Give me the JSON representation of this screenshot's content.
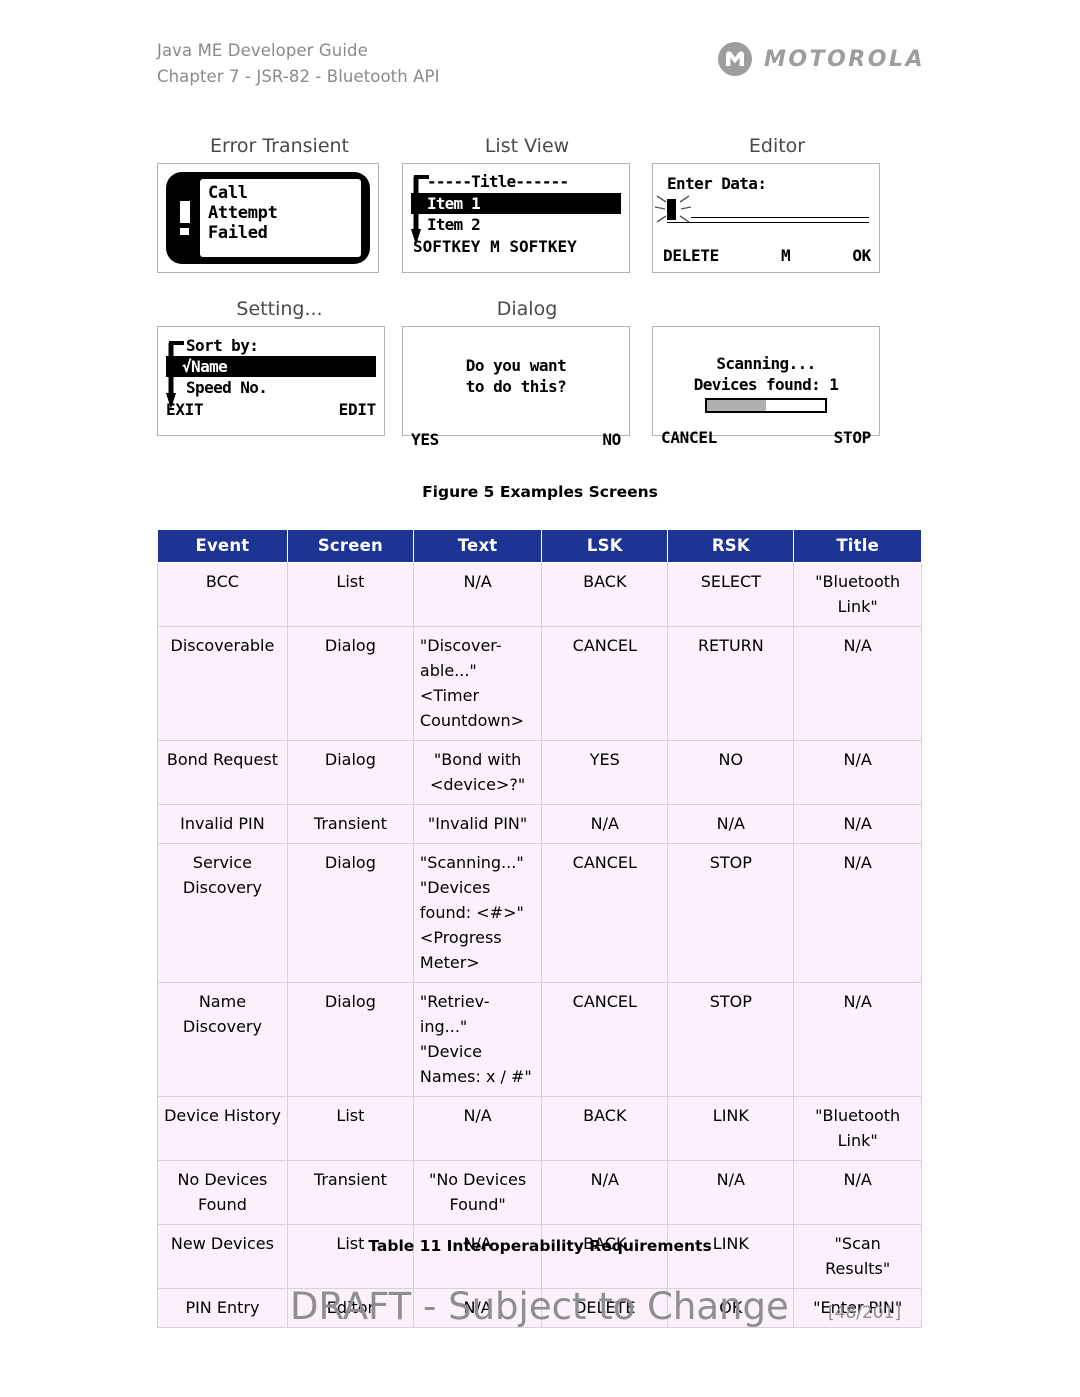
{
  "header": {
    "doc_title": "Java ME Developer Guide",
    "chapter": "Chapter 7 - JSR-82 - Bluetooth API",
    "brand": "MOTOROLA"
  },
  "figure": {
    "caption": "Figure 5 Examples Screens",
    "screens": [
      {
        "label": "Error Transient",
        "kind": "transient",
        "icon": "exclamation-icon",
        "lines": [
          "Call",
          "Attempt",
          "Failed"
        ]
      },
      {
        "label": "List View",
        "kind": "list",
        "title_line": "-----Title------",
        "selected_item": "Item 1",
        "item": "Item 2",
        "softkeys": "SOFTKEY M SOFTKEY",
        "scroll_indicator": "down-arrow-icon"
      },
      {
        "label": "Editor",
        "kind": "editor",
        "prompt": "Enter Data:",
        "value": "",
        "lsk": "DELETE",
        "msk": "M",
        "rsk": "OK",
        "cursor": "blinking-cursor-icon"
      },
      {
        "label": "Setting...",
        "kind": "setting",
        "title_line": "Sort by:",
        "selected_item": "√Name",
        "item": "Speed No.",
        "lsk": "EXIT",
        "rsk": "EDIT",
        "scroll_indicator": "down-arrow-icon"
      },
      {
        "label": "Dialog",
        "kind": "dialog",
        "message_line1": "Do you want",
        "message_line2": "to do this?",
        "lsk": "YES",
        "rsk": "NO"
      },
      {
        "label": "",
        "kind": "progress",
        "message_line1": "Scanning...",
        "message_line2": "Devices found: 1",
        "progress_percent": 50,
        "lsk": "CANCEL",
        "rsk": "STOP"
      }
    ]
  },
  "table": {
    "caption": "Table 11 Interoperability Requirements",
    "columns": [
      "Event",
      "Screen",
      "Text",
      "LSK",
      "RSK",
      "Title"
    ],
    "rows": [
      {
        "event": "BCC",
        "screen": "List",
        "text": "N/A",
        "lsk": "BACK",
        "rsk": "SELECT",
        "title": "\"Bluetooth Link\""
      },
      {
        "event": "Discoverable",
        "screen": "Dialog",
        "text": "\"Discover-able...\"\n<Timer Countdown>",
        "lsk": "CANCEL",
        "rsk": "RETURN",
        "title": "N/A"
      },
      {
        "event": "Bond Request",
        "screen": "Dialog",
        "text": "\"Bond with <device>?\"",
        "lsk": "YES",
        "rsk": "NO",
        "title": "N/A"
      },
      {
        "event": "Invalid PIN",
        "screen": "Transient",
        "text": "\"Invalid PIN\"",
        "lsk": "N/A",
        "rsk": "N/A",
        "title": "N/A"
      },
      {
        "event": "Service Discovery",
        "screen": "Dialog",
        "text": "\"Scanning...\"\n\"Devices found: <#>\"\n<Progress Meter>",
        "lsk": "CANCEL",
        "rsk": "STOP",
        "title": "N/A"
      },
      {
        "event": "Name Discovery",
        "screen": "Dialog",
        "text": "\"Retriev-ing...\"\n\"Device Names: x / #\"",
        "lsk": "CANCEL",
        "rsk": "STOP",
        "title": "N/A"
      },
      {
        "event": "Device History",
        "screen": "List",
        "text": "N/A",
        "lsk": "BACK",
        "rsk": "LINK",
        "title": "\"Bluetooth Link\""
      },
      {
        "event": "No Devices Found",
        "screen": "Transient",
        "text": "\"No Devices Found\"",
        "lsk": "N/A",
        "rsk": "N/A",
        "title": "N/A"
      },
      {
        "event": "New Devices",
        "screen": "List",
        "text": "N/A",
        "lsk": "BACK",
        "rsk": "LINK",
        "title": "\"Scan Results\""
      },
      {
        "event": "PIN Entry",
        "screen": "Editor",
        "text": "N/A",
        "lsk": "DELETE",
        "rsk": "OK",
        "title": "\"Enter PIN\""
      }
    ]
  },
  "footer": {
    "draft_notice": "DRAFT - Subject to Change",
    "page_number": "[48/201]"
  },
  "colors": {
    "table_header_bg": "#1d3494",
    "table_row_bg": "#fbf0fb",
    "header_text": "#8a8a8a",
    "draft_text": "#8e8e8e"
  }
}
